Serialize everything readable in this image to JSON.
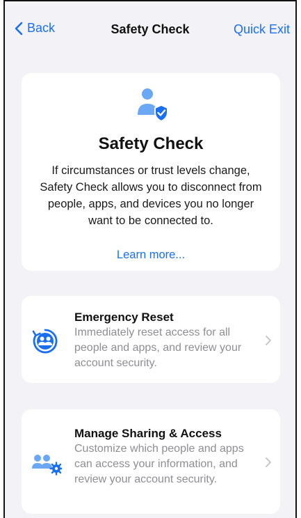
{
  "nav": {
    "back_label": "Back",
    "title": "Safety Check",
    "quick_exit_label": "Quick Exit"
  },
  "hero": {
    "icon": "person-shield-icon",
    "title": "Safety Check",
    "description": "If circumstances or trust levels change, Safety Check allows you to disconnect from people, apps, and devices you no longer want to be connected to.",
    "link_label": "Learn more..."
  },
  "options": [
    {
      "icon": "emergency-reset-icon",
      "title": "Emergency Reset",
      "description": "Immediately reset access for all people and apps, and review your account security."
    },
    {
      "icon": "manage-sharing-icon",
      "title": "Manage Sharing & Access",
      "description": "Customize which people and apps can access your information, and review your account security."
    }
  ],
  "colors": {
    "accent": "#1a6ff0",
    "background": "#f2f2f7",
    "card": "#ffffff",
    "secondary_text": "#8e8e93"
  }
}
